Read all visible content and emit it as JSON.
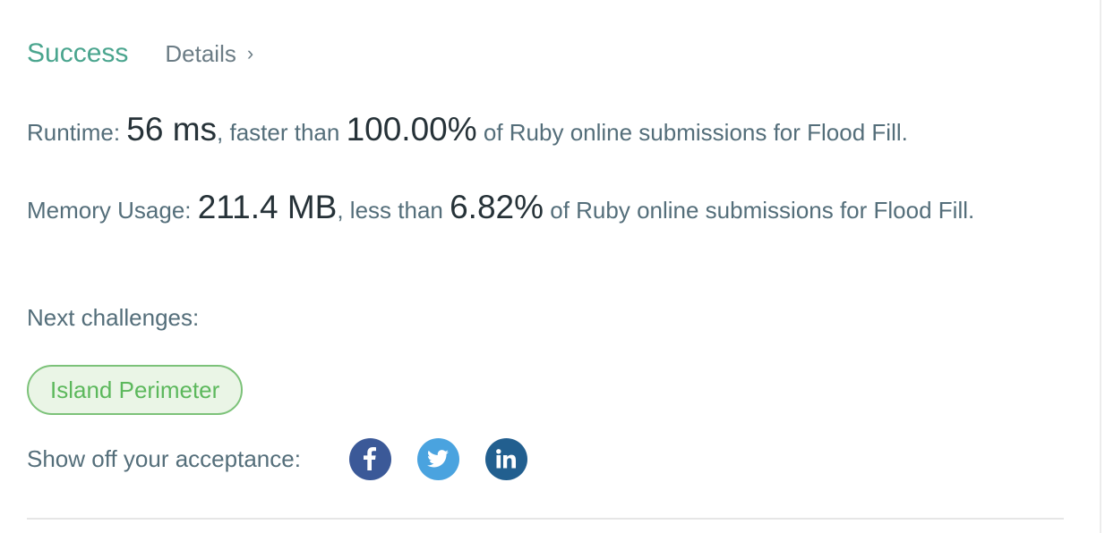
{
  "result": {
    "status": "Success",
    "details_label": "Details",
    "details_chevron": "›"
  },
  "runtime": {
    "label": "Runtime: ",
    "value": "56 ms",
    "comparison": ", faster than ",
    "percent": "100.00%",
    "suffix": " of Ruby online submissions for Flood Fill."
  },
  "memory": {
    "label": "Memory Usage: ",
    "value": "211.4 MB",
    "comparison": ", less than ",
    "percent": "6.82%",
    "suffix": " of Ruby online submissions for Flood Fill."
  },
  "next_challenges": {
    "label": "Next challenges:",
    "items": [
      "Island Perimeter"
    ]
  },
  "share": {
    "label": "Show off your acceptance:",
    "icons": [
      "facebook-icon",
      "twitter-icon",
      "linkedin-icon"
    ]
  },
  "colors": {
    "success": "#4aa58e",
    "tag_border": "#7cc279",
    "tag_bg": "#eaf5e6",
    "facebook": "#3b5998",
    "twitter": "#4aa3df",
    "linkedin": "#225f8f"
  }
}
